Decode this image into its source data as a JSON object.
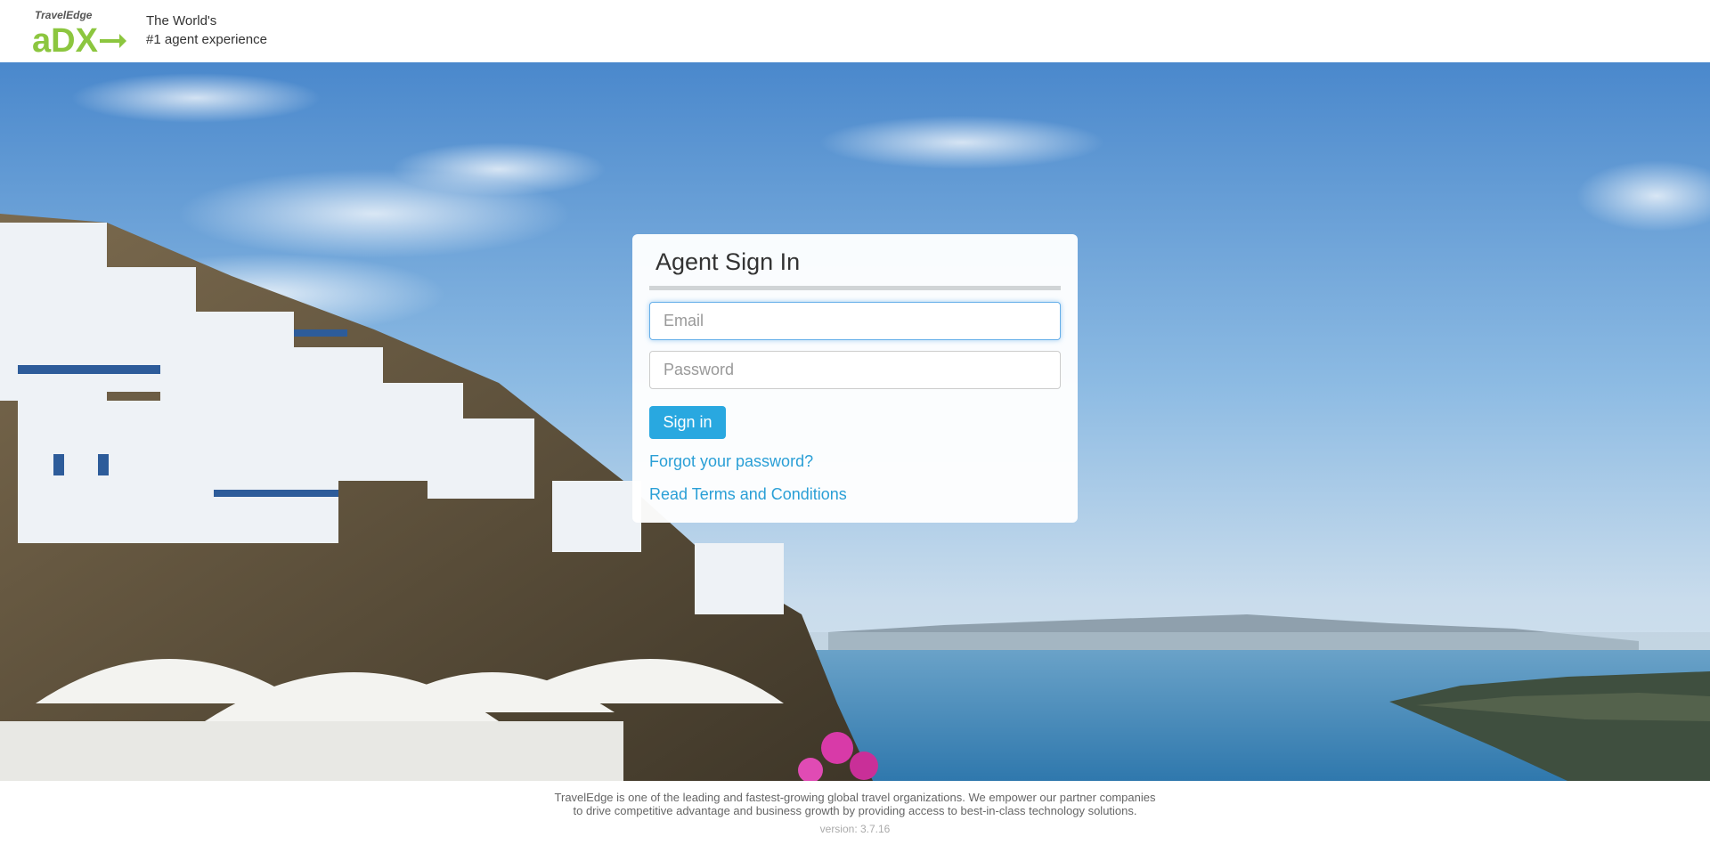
{
  "header": {
    "logo_brand": "TravelEdge",
    "logo_wordmark": "aDX",
    "tagline_line1": "The World's",
    "tagline_line2": "#1 agent experience"
  },
  "signin": {
    "title": "Agent Sign In",
    "email_placeholder": "Email",
    "email_value": "",
    "password_placeholder": "Password",
    "password_value": "",
    "submit_label": "Sign in",
    "forgot_link": "Forgot your password?",
    "terms_link": "Read Terms and Conditions"
  },
  "footer": {
    "line1": "TravelEdge is one of the leading and fastest-growing global travel organizations. We empower our partner companies",
    "line2": "to drive competitive advantage and business growth by providing access to best-in-class technology solutions.",
    "version": "version: 3.7.16"
  },
  "colors": {
    "accent": "#29a8e0",
    "link": "#2a9fd6",
    "logo_green": "#8cc63f",
    "logo_blue": "#2a8fd6",
    "sky_top": "#4f8fd1",
    "sea": "#3f86b8"
  },
  "hero": {
    "image": "santorini-coastline-photo"
  }
}
